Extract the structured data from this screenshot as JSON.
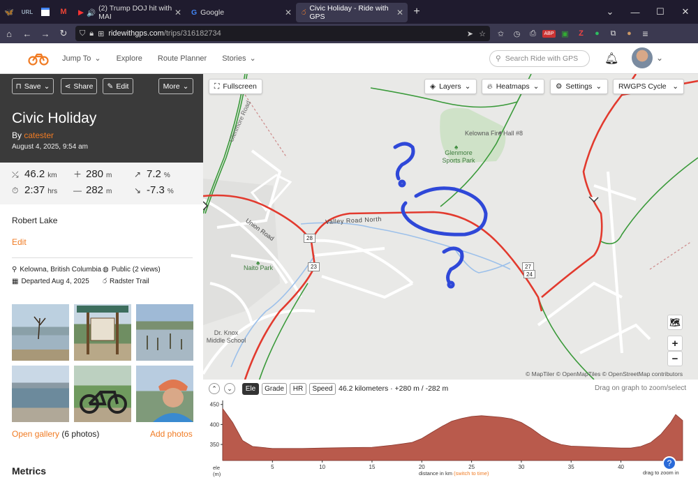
{
  "browser": {
    "tabs": [
      {
        "label": "(2) Trump DOJ hit with MAI"
      },
      {
        "label": "Google"
      },
      {
        "label": "Civic Holiday - Ride with GPS"
      }
    ],
    "pinned": [
      "bluesky-icon",
      "url-icon",
      "calendar-icon",
      "gmail-icon"
    ],
    "url": {
      "host": "ridewithgps.com",
      "path": "/trips/316182734"
    }
  },
  "site": {
    "nav": [
      "Jump To",
      "Explore",
      "Route Planner",
      "Stories"
    ],
    "search_placeholder": "Search Ride with GPS"
  },
  "sidebar": {
    "buttons": {
      "save": "Save",
      "share": "Share",
      "edit": "Edit",
      "more": "More"
    },
    "title": "Civic Holiday",
    "by": "By",
    "author": "catester",
    "date": "August 4, 2025, 9:54 am",
    "stats": {
      "distance": "46.2",
      "distance_unit": "km",
      "elev_gain": "280",
      "elev_gain_unit": "m",
      "grade_up": "7.2",
      "grade_up_unit": "%",
      "time": "2:37",
      "time_unit": "hrs",
      "elev_loss": "282",
      "elev_loss_unit": "m",
      "grade_down": "-7.3",
      "grade_down_unit": "%"
    },
    "description": "Robert Lake",
    "edit_link": "Edit",
    "location": "Kelowna, British Columbia",
    "visibility": "Public (2 views)",
    "departed": "Departed Aug 4, 2025",
    "bike": "Radster Trail",
    "open_gallery": "Open gallery",
    "photo_count": "(6 photos)",
    "add_photos": "Add photos",
    "metrics": "Metrics"
  },
  "map": {
    "fullscreen": "Fullscreen",
    "layers": "Layers",
    "heatmaps": "Heatmaps",
    "settings": "Settings",
    "map_style": "RWGPS Cycle",
    "labels": {
      "glenmore_road": "Glenmore Road",
      "fire_hall": "Kelowna Fire Hall #8",
      "sports_park": "Glenmore Sports Park",
      "valley_road": "Valley Road North",
      "union_road": "Union Road",
      "naito_park": "Naito Park",
      "school": "Dr. Knox Middle School"
    },
    "markers": [
      "28",
      "23",
      "27",
      "24"
    ],
    "attribution": "© MapTiler © OpenMapTiles © OpenStreetMap contributors",
    "zoom_in": "+",
    "zoom_out": "−"
  },
  "elevation": {
    "tabs": [
      "Ele",
      "Grade",
      "HR",
      "Speed"
    ],
    "summary": "46.2 kilometers · +280 m / -282 m",
    "hint": "Drag on graph to zoom/select",
    "yticks": [
      "450",
      "400",
      "350"
    ],
    "xticks": [
      "5",
      "10",
      "15",
      "20",
      "25",
      "30",
      "35",
      "40"
    ],
    "ylabel_top": "ele",
    "ylabel_bottom": "(m)",
    "xlabel": "distance in km",
    "xlabel_link": "(switch to time)",
    "zoom_hint": "drag to zoom in"
  },
  "chart_data": {
    "type": "area",
    "xlabel": "distance in km",
    "ylabel": "ele (m)",
    "xlim": [
      0,
      46.2
    ],
    "ylim": [
      310,
      460
    ],
    "x": [
      0,
      1,
      2,
      3,
      5,
      8,
      10,
      12,
      15,
      17,
      19,
      20,
      21,
      22,
      23,
      24,
      25,
      26,
      27,
      28,
      29,
      30,
      31,
      32,
      33,
      34,
      35,
      36,
      37,
      38,
      39,
      40,
      41,
      42,
      43,
      44,
      45,
      45.5,
      46.2
    ],
    "y": [
      440,
      405,
      360,
      345,
      340,
      340,
      341,
      342,
      343,
      348,
      355,
      365,
      380,
      395,
      408,
      415,
      420,
      422,
      420,
      418,
      414,
      405,
      390,
      372,
      358,
      350,
      346,
      345,
      344,
      343,
      342,
      341,
      341,
      345,
      355,
      375,
      405,
      425,
      410
    ]
  }
}
